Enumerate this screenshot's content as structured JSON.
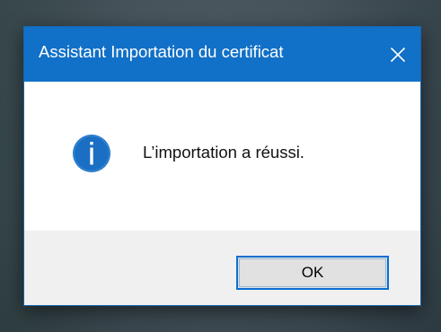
{
  "dialog": {
    "title": "Assistant Importation du certificat",
    "message": "L’importation a réussi.",
    "ok_label": "OK",
    "icons": {
      "close": "close-icon",
      "info": "info-icon"
    },
    "colors": {
      "titlebar": "#1170c7",
      "info_icon": "#1a6fc4",
      "button_border": "#0b6fd0"
    }
  }
}
